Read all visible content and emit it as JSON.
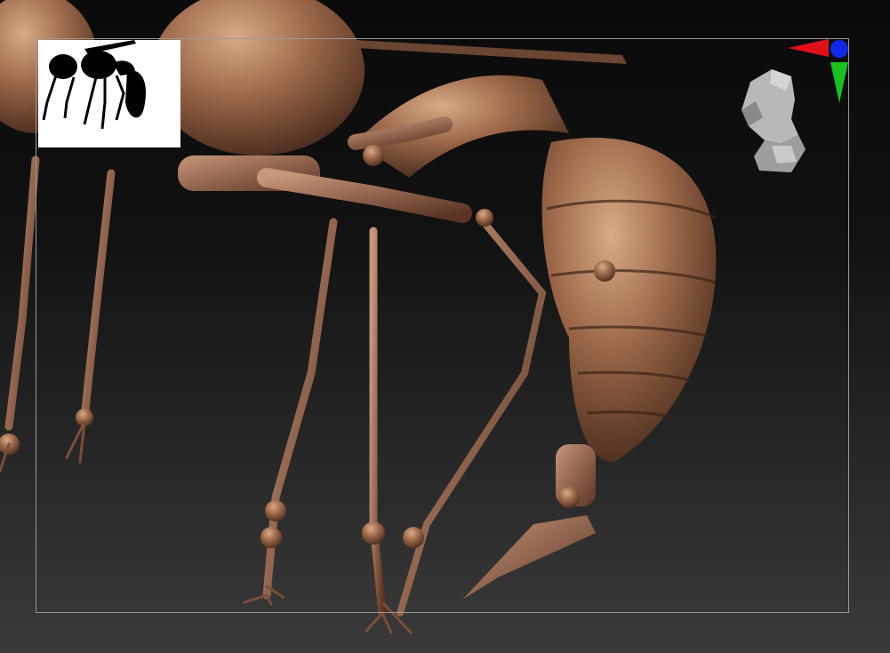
{
  "viewport": {
    "background_top": "#0a0a0a",
    "background_bottom": "#3a3a3a",
    "frame_color": "#9a9a9a"
  },
  "model": {
    "material_base": "#8a5a3e",
    "material_light": "#c99a78",
    "material_dark": "#3b2216"
  },
  "navigator": {
    "thumbnail_icon": "wasp-silhouette-icon",
    "thumbnail_background": "#ffffff"
  },
  "axis_gizmo": {
    "x_axis_color": "#e0101a",
    "y_axis_color": "#18c020",
    "z_axis_color": "#1028e8"
  },
  "view_head": {
    "icon": "orientation-head-icon",
    "color": "#b8b8b8"
  }
}
